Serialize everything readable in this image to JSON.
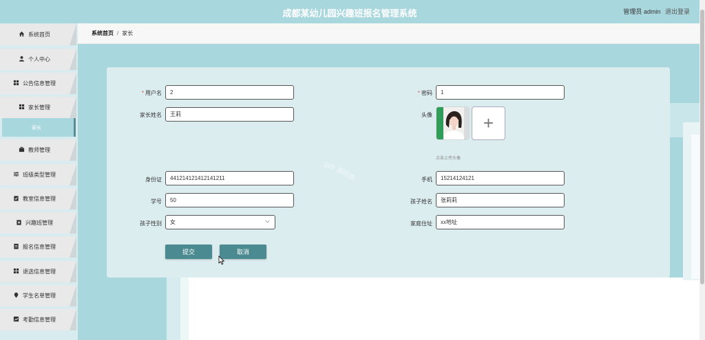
{
  "header": {
    "title": "成都某幼儿园兴趣班报名管理系统",
    "user_role": "管理员",
    "user_name": "admin",
    "logout": "退出登录"
  },
  "sidebar": {
    "items": [
      {
        "label": "系统首页",
        "icon": "home-icon"
      },
      {
        "label": "个人中心",
        "icon": "user-icon"
      },
      {
        "label": "公告信息管理",
        "icon": "grid-icon"
      },
      {
        "label": "家长管理",
        "icon": "grid-icon"
      },
      {
        "label": "教师管理",
        "icon": "briefcase-icon"
      },
      {
        "label": "班级类型管理",
        "icon": "sliders-icon"
      },
      {
        "label": "教室信息管理",
        "icon": "clipboard-check-icon"
      },
      {
        "label": "兴趣班管理",
        "icon": "clipboard-x-icon"
      },
      {
        "label": "报名信息管理",
        "icon": "document-icon"
      },
      {
        "label": "退选信息管理",
        "icon": "grid-icon"
      },
      {
        "label": "学生名单管理",
        "icon": "pin-icon"
      },
      {
        "label": "考勤信息管理",
        "icon": "chart-icon"
      }
    ],
    "active_sub": "家长"
  },
  "breadcrumb": {
    "home": "系统首页",
    "separator": "/",
    "current": "家长"
  },
  "form": {
    "username": {
      "label": "用户名",
      "value": "2",
      "required": true
    },
    "password": {
      "label": "密码",
      "value": "1",
      "required": true
    },
    "parent_name": {
      "label": "家长姓名",
      "value": "王莉"
    },
    "avatar": {
      "label": "头像",
      "hint": "点击上传头像",
      "add": "+"
    },
    "id_card": {
      "label": "身份证",
      "value": "441214121412141211"
    },
    "phone": {
      "label": "手机",
      "value": "15214124121"
    },
    "student_no": {
      "label": "学号",
      "value": "50"
    },
    "child_name": {
      "label": "孩子姓名",
      "value": "张莉莉"
    },
    "child_gender": {
      "label": "孩子性别",
      "value": "女"
    },
    "address": {
      "label": "家庭住址",
      "value": "xx地址"
    },
    "required_mark": "*",
    "submit": "提交",
    "cancel": "取消"
  },
  "watermark": "gzh 源码库",
  "colors": {
    "accent": "#a9d7de",
    "button": "#4a8a90",
    "active_border": "#5a8c93",
    "required": "#e25555"
  }
}
